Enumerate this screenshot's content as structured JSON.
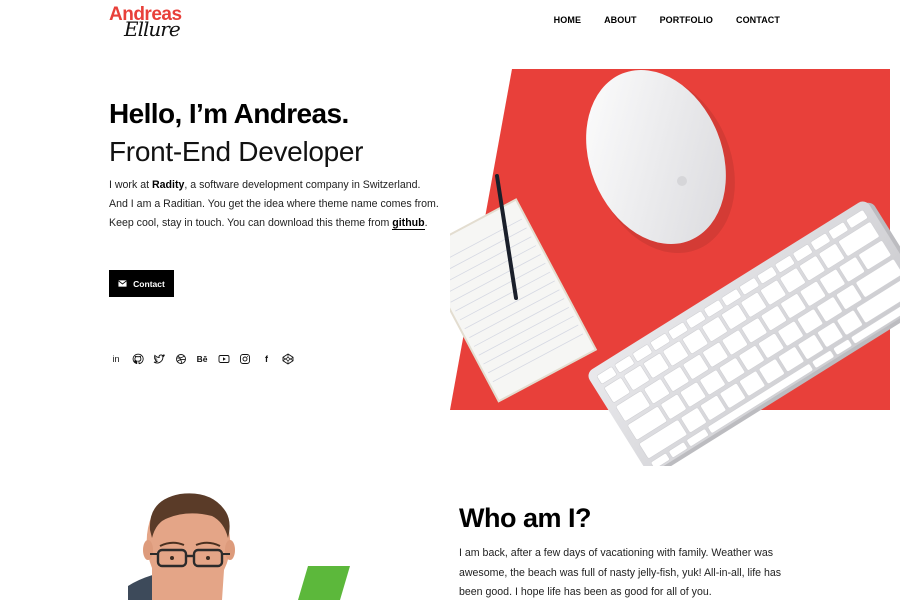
{
  "brand": {
    "name_top": "Andreas",
    "name_bottom": "Ellure"
  },
  "nav": {
    "items": [
      {
        "label": "HOME"
      },
      {
        "label": "ABOUT"
      },
      {
        "label": "PORTFOLIO"
      },
      {
        "label": "CONTACT"
      }
    ]
  },
  "hero": {
    "hello": "Hello, I’m Andreas.",
    "role": "Front-End Developer",
    "desc_part1": "I work at ",
    "company": "Radity",
    "desc_part2": ", a software development company in Switzerland. And I am a Raditian. You get the idea where theme name comes from. Keep cool, stay in touch. You can download this theme from ",
    "github": "github",
    "desc_end": ".",
    "contact_label": "Contact"
  },
  "social": {
    "icons": [
      "linkedin-icon",
      "github-icon",
      "twitter-icon",
      "dribbble-icon",
      "behance-icon",
      "youtube-icon",
      "instagram-icon",
      "facebook-icon",
      "codepen-icon"
    ],
    "behance_text": "Bē",
    "facebook_text": "f",
    "linkedin_text": "in"
  },
  "about": {
    "title": "Who am I?",
    "text": "I am back, after a few days of vacationing with family. Weather was awesome, the beach was full of nasty jelly-fish, yuk! All-in-all, life has been good. I hope life has been as good for all of you."
  },
  "colors": {
    "accent": "#e8403a",
    "green": "#5cb83b",
    "black": "#000000"
  }
}
